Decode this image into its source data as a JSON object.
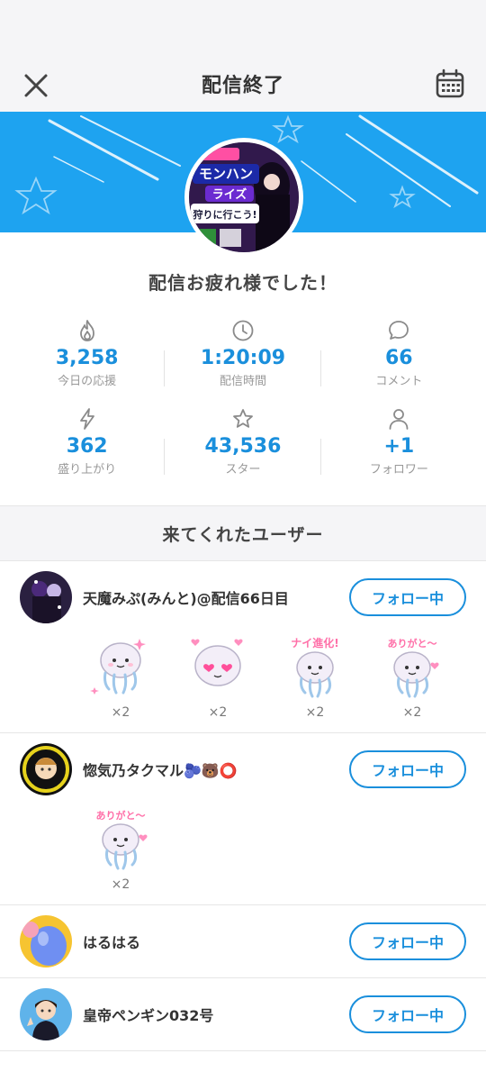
{
  "nav": {
    "title": "配信終了"
  },
  "thanks": "配信お疲れ様でした！",
  "stats": [
    {
      "icon": "flame-icon",
      "value": "3,258",
      "label": "今日の応援"
    },
    {
      "icon": "clock-icon",
      "value": "1:20:09",
      "label": "配信時間"
    },
    {
      "icon": "comment-icon",
      "value": "66",
      "label": "コメント"
    },
    {
      "icon": "lightning-icon",
      "value": "362",
      "label": "盛り上がり"
    },
    {
      "icon": "star-icon",
      "value": "43,536",
      "label": "スター"
    },
    {
      "icon": "person-icon",
      "value": "+1",
      "label": "フォロワー"
    }
  ],
  "section_title": "来てくれたユーザー",
  "banner_thumb": {
    "line1": "モンハン",
    "line2": "ライズ",
    "line3": "狩りに行こう!"
  },
  "users": [
    {
      "name": "天魔みぷ(みんと)@配信66日目",
      "follow_label": "フォロー中",
      "gifts": [
        {
          "label": "",
          "count": "×2"
        },
        {
          "label": "",
          "count": "×2"
        },
        {
          "label": "ナイ進化!",
          "count": "×2"
        },
        {
          "label": "ありがと〜",
          "count": "×2"
        }
      ]
    },
    {
      "name": "惚気乃タクマル🫐🐻⭕",
      "follow_label": "フォロー中",
      "gifts": [
        {
          "label": "ありがと〜",
          "count": "×2"
        }
      ]
    },
    {
      "name": "はるはる",
      "follow_label": "フォロー中",
      "gifts": []
    },
    {
      "name": "皇帝ペンギン032号",
      "follow_label": "フォロー中",
      "gifts": []
    }
  ],
  "colors": {
    "accent": "#1a8fdc",
    "banner": "#1ea3f0"
  }
}
